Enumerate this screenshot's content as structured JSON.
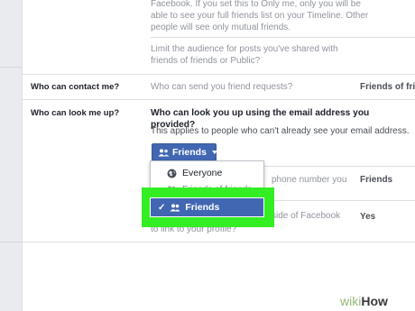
{
  "top_section": {
    "line1": "Facebook. If you set this to Only me, only you will be",
    "line2": "able to see your full friends list on your Timeline. Other",
    "line3": "people will see only mutual friends.",
    "limit_line1": "Limit the audience for posts you've shared with",
    "limit_line2": "friends of friends or Public?"
  },
  "contact_row": {
    "label": "Who can contact me?",
    "question": "Who can send you friend requests?",
    "value": "Friends of fri"
  },
  "lookup_row": {
    "label": "Who can look me up?",
    "question": "Who can look you up using the email address you provided?",
    "subtext": "This applies to people who can't already see your email address.",
    "button_label": "Friends",
    "phone_question_fragment": "phone number you",
    "phone_value": "Friends",
    "search_fragment": "side of Facebook",
    "search_value": "Yes",
    "link_line": "to link to your profile?"
  },
  "dropdown": {
    "options": [
      {
        "label": "Everyone",
        "icon": "globe-icon"
      },
      {
        "label": "Friends of friends",
        "icon": "friends-of-friends-icon"
      },
      {
        "label": "Friends",
        "icon": "friends-icon",
        "selected": true
      }
    ]
  },
  "watermark": {
    "wiki": "wiki",
    "how": "How"
  },
  "colors": {
    "brand_blue": "#4267b2",
    "highlight_green": "#33ee22",
    "background": "#e9ebee",
    "muted_text": "#90949c"
  }
}
